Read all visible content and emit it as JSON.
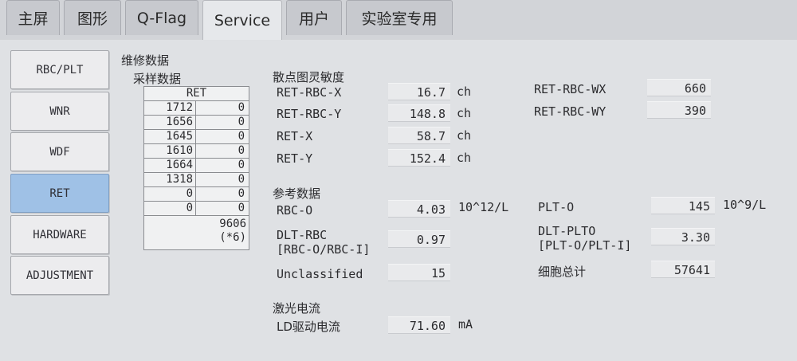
{
  "tabs": [
    "主屏",
    "图形",
    "Q-Flag",
    "Service",
    "用户",
    "实验室专用"
  ],
  "active_tab": "Service",
  "menu": [
    "RBC/PLT",
    "WNR",
    "WDF",
    "RET",
    "HARDWARE",
    "ADJUSTMENT"
  ],
  "active_menu": "RET",
  "maint_title": "维修数据",
  "sample": {
    "title": "采样数据",
    "header": "RET",
    "rows": [
      [
        "1712",
        "0"
      ],
      [
        "1656",
        "0"
      ],
      [
        "1645",
        "0"
      ],
      [
        "1610",
        "0"
      ],
      [
        "1664",
        "0"
      ],
      [
        "1318",
        "0"
      ],
      [
        "0",
        "0"
      ],
      [
        "0",
        "0"
      ]
    ],
    "total": "9606",
    "total_note": "(*6)"
  },
  "scatter": {
    "title": "散点图灵敏度",
    "left": [
      {
        "label": "RET-RBC-X",
        "value": "16.7",
        "unit": "ch"
      },
      {
        "label": "RET-RBC-Y",
        "value": "148.8",
        "unit": "ch"
      },
      {
        "label": "RET-X",
        "value": "58.7",
        "unit": "ch"
      },
      {
        "label": "RET-Y",
        "value": "152.4",
        "unit": "ch"
      }
    ],
    "right": [
      {
        "label": "RET-RBC-WX",
        "value": "660"
      },
      {
        "label": "RET-RBC-WY",
        "value": "390"
      }
    ]
  },
  "reference": {
    "title": "参考数据",
    "rbc_o": {
      "label": "RBC-O",
      "value": "4.03",
      "unit": "10^12/L"
    },
    "plt_o": {
      "label": "PLT-O",
      "value": "145",
      "unit": "10^9/L"
    },
    "dlt_rbc": {
      "label1": "DLT-RBC",
      "label2": "[RBC-O/RBC-I]",
      "value": "0.97"
    },
    "dlt_plto": {
      "label1": "DLT-PLTO",
      "label2": "[PLT-O/PLT-I]",
      "value": "3.30"
    },
    "unclassified": {
      "label": "Unclassified",
      "value": "15"
    },
    "cell_total": {
      "label": "细胞总计",
      "value": "57641"
    }
  },
  "laser": {
    "title": "激光电流",
    "ld": {
      "label": "LD驱动电流",
      "value": "71.60",
      "unit": "mA"
    }
  }
}
